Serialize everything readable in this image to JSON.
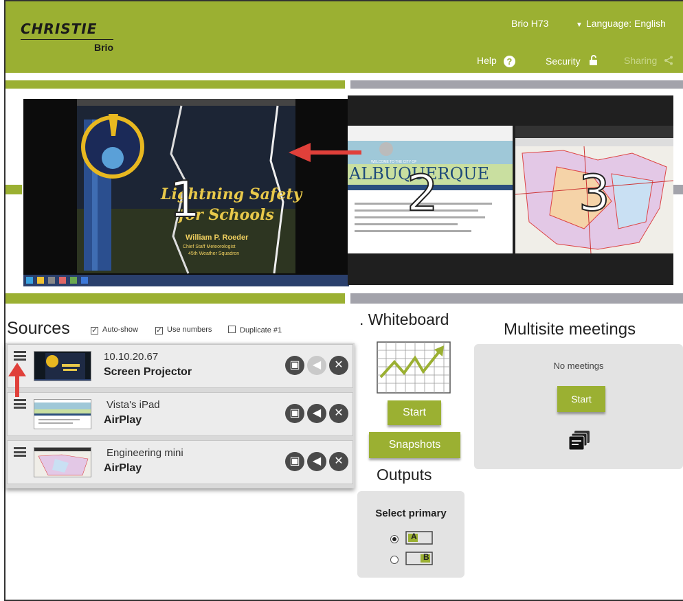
{
  "app": {
    "brand": "CHRISTIE",
    "product": "Brio",
    "device_name": "Brio H73",
    "language_label": "Language: English",
    "help_label": "Help",
    "security_label": "Security",
    "sharing_label": "Sharing",
    "accent_color": "#9bb032"
  },
  "layout_preview": {
    "window1": {
      "number": "1",
      "title_line1": "Lightning Safety",
      "title_line2": "for Schools",
      "presenter": "William P. Roeder",
      "presenter_title": "Chief Staff Meteorologist",
      "presenter_org": "45th Weather Squadron"
    },
    "window2": {
      "number": "2",
      "city_text": "ALBUQUERQUE",
      "welcome": "WELCOME TO THE CITY OF"
    },
    "window3": {
      "number": "3"
    }
  },
  "sources": {
    "title": "Sources",
    "options": [
      {
        "label": "Auto-show",
        "checked": true
      },
      {
        "label": "Use numbers",
        "checked": true
      },
      {
        "label": "Duplicate #1",
        "checked": false
      }
    ],
    "items": [
      {
        "address": "10.10.20.67",
        "type": "Screen Projector",
        "audio_enabled": false
      },
      {
        "address": "Vista's iPad",
        "type": "AirPlay",
        "audio_enabled": true
      },
      {
        "address": "Engineering mini",
        "type": "AirPlay",
        "audio_enabled": true
      }
    ]
  },
  "whiteboard": {
    "title": ". Whiteboard",
    "start_label": "Start",
    "snapshots_label": "Snapshots"
  },
  "outputs": {
    "title": "Outputs",
    "select_label": "Select primary",
    "options": [
      {
        "label": "A",
        "selected": true
      },
      {
        "label": "B",
        "selected": false
      }
    ]
  },
  "multisite": {
    "title": "Multisite meetings",
    "empty_text": "No meetings",
    "start_label": "Start"
  }
}
